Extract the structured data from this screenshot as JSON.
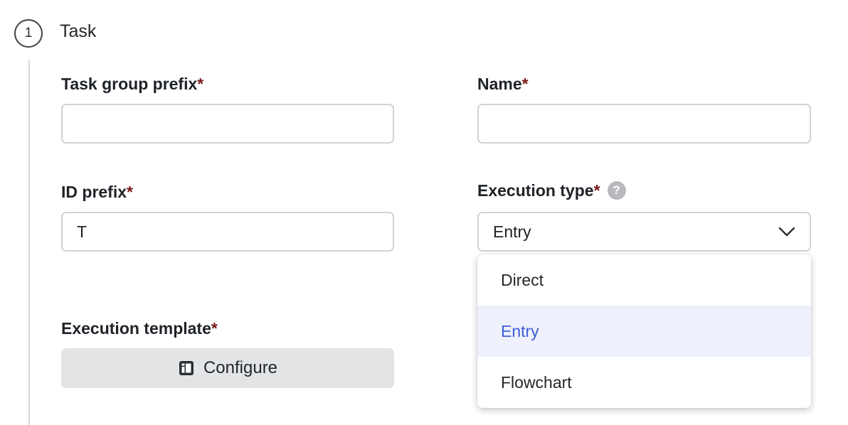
{
  "step": {
    "number": "1",
    "title": "Task"
  },
  "fields": {
    "task_group_prefix": {
      "label": "Task group prefix",
      "required_mark": "*",
      "value": ""
    },
    "name": {
      "label": "Name",
      "required_mark": "*",
      "value": ""
    },
    "id_prefix": {
      "label": "ID prefix",
      "required_mark": "*",
      "value": "T"
    },
    "execution_type": {
      "label": "Execution type",
      "required_mark": "*",
      "help_icon": "?",
      "selected": "Entry",
      "icon": "chevron-down-icon"
    },
    "execution_template": {
      "label": "Execution template",
      "required_mark": "*",
      "button_label": "Configure",
      "button_icon": "template-icon"
    }
  },
  "dropdown": {
    "options": [
      "Direct",
      "Entry",
      "Flowchart"
    ],
    "highlighted": "Entry"
  },
  "colors": {
    "required": "#7b1a1a",
    "highlight_bg": "#eef0fb",
    "highlight_text": "#3f5fd9",
    "button_bg": "#e3e4e6"
  }
}
